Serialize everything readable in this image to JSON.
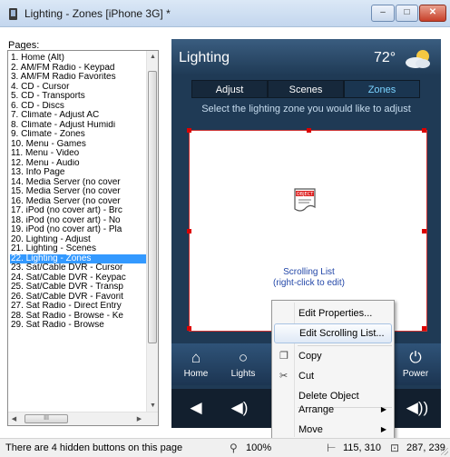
{
  "window": {
    "title": "Lighting - Zones [iPhone 3G] *"
  },
  "pages": {
    "label": "Pages:",
    "items": [
      "1. Home (Alt)",
      "2. AM/FM Radio - Keypad",
      "3. AM/FM Radio Favorites",
      "4. CD - Cursor",
      "5. CD - Transports",
      "6. CD - Discs",
      "7. Climate - Adjust AC",
      "8. Climate - Adjust Humidi",
      "9. Climate - Zones",
      "10. Menu - Games",
      "11. Menu - Video",
      "12. Menu - Audio",
      "13. Info Page",
      "14. Media Server (no cover",
      "15. Media Server (no cover",
      "16. Media Server (no cover",
      "17. iPod (no cover art) - Brc",
      "18. iPod (no cover art) - No",
      "19. iPod (no cover art) - Pla",
      "20. Lighting - Adjust",
      "21. Lighting - Scenes",
      "22. Lighting - Zones",
      "23. Sat/Cable DVR - Cursor",
      "24. Sat/Cable DVR - Keypac",
      "25. Sat/Cable DVR - Transp",
      "26. Sat/Cable DVR - Favorit",
      "27. Sat Radio - Direct Entry",
      "28. Sat Radio - Browse - Ke",
      "29. Sat Radio - Browse"
    ],
    "selected": "22. Lighting - Zones"
  },
  "device": {
    "title": "Lighting",
    "temperature": "72°",
    "tabs": [
      "Adjust",
      "Scenes",
      "Zones"
    ],
    "active_tab": "Zones",
    "instruction": "Select the lighting zone you would like to adjust",
    "object_icon_label": "OBJECT",
    "list_caption_line1": "Scrolling List",
    "list_caption_line2": "(right-click to edit)",
    "buttons": [
      {
        "label": "Home",
        "icon": "home-icon"
      },
      {
        "label": "Lights",
        "icon": "bulb-icon"
      },
      {
        "label": "Power",
        "icon": "power-icon"
      }
    ],
    "volume_icons": [
      "speaker-icon",
      "volume-low-icon",
      "volume-high-icon"
    ]
  },
  "context_menu": {
    "items": [
      {
        "label": "Edit Properties...",
        "highlighted": false
      },
      {
        "label": "Edit Scrolling List...",
        "highlighted": true
      },
      {
        "label": "Copy",
        "icon": "copy-icon"
      },
      {
        "label": "Cut",
        "icon": "scissors-icon"
      },
      {
        "label": "Delete Object"
      },
      {
        "label": "Arrange",
        "submenu": true
      },
      {
        "label": "Move",
        "submenu": true
      }
    ]
  },
  "status": {
    "message": "There are 4 hidden buttons on this page",
    "zoom": "100%",
    "position": "115, 310",
    "size": "287, 239"
  },
  "colors": {
    "selection": "#3399ff",
    "device_bg": "#1f3a55",
    "active_tab_text": "#7bd3ff",
    "handle": "#dd0000"
  }
}
